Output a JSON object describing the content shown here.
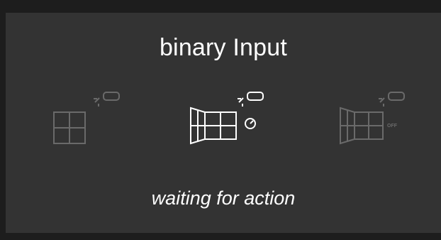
{
  "widget": {
    "title": "binary Input",
    "status": "waiting for action",
    "colors": {
      "background": "#333333",
      "text": "#ffffff",
      "active_icon": "#ffffff",
      "inactive_icon": "#6a6a6a"
    }
  },
  "states": [
    {
      "icon": "window-closed-icon",
      "active": false
    },
    {
      "icon": "window-open-timer-icon",
      "active": true
    },
    {
      "icon": "window-open-off-icon",
      "active": false,
      "tag": "OFF"
    }
  ]
}
